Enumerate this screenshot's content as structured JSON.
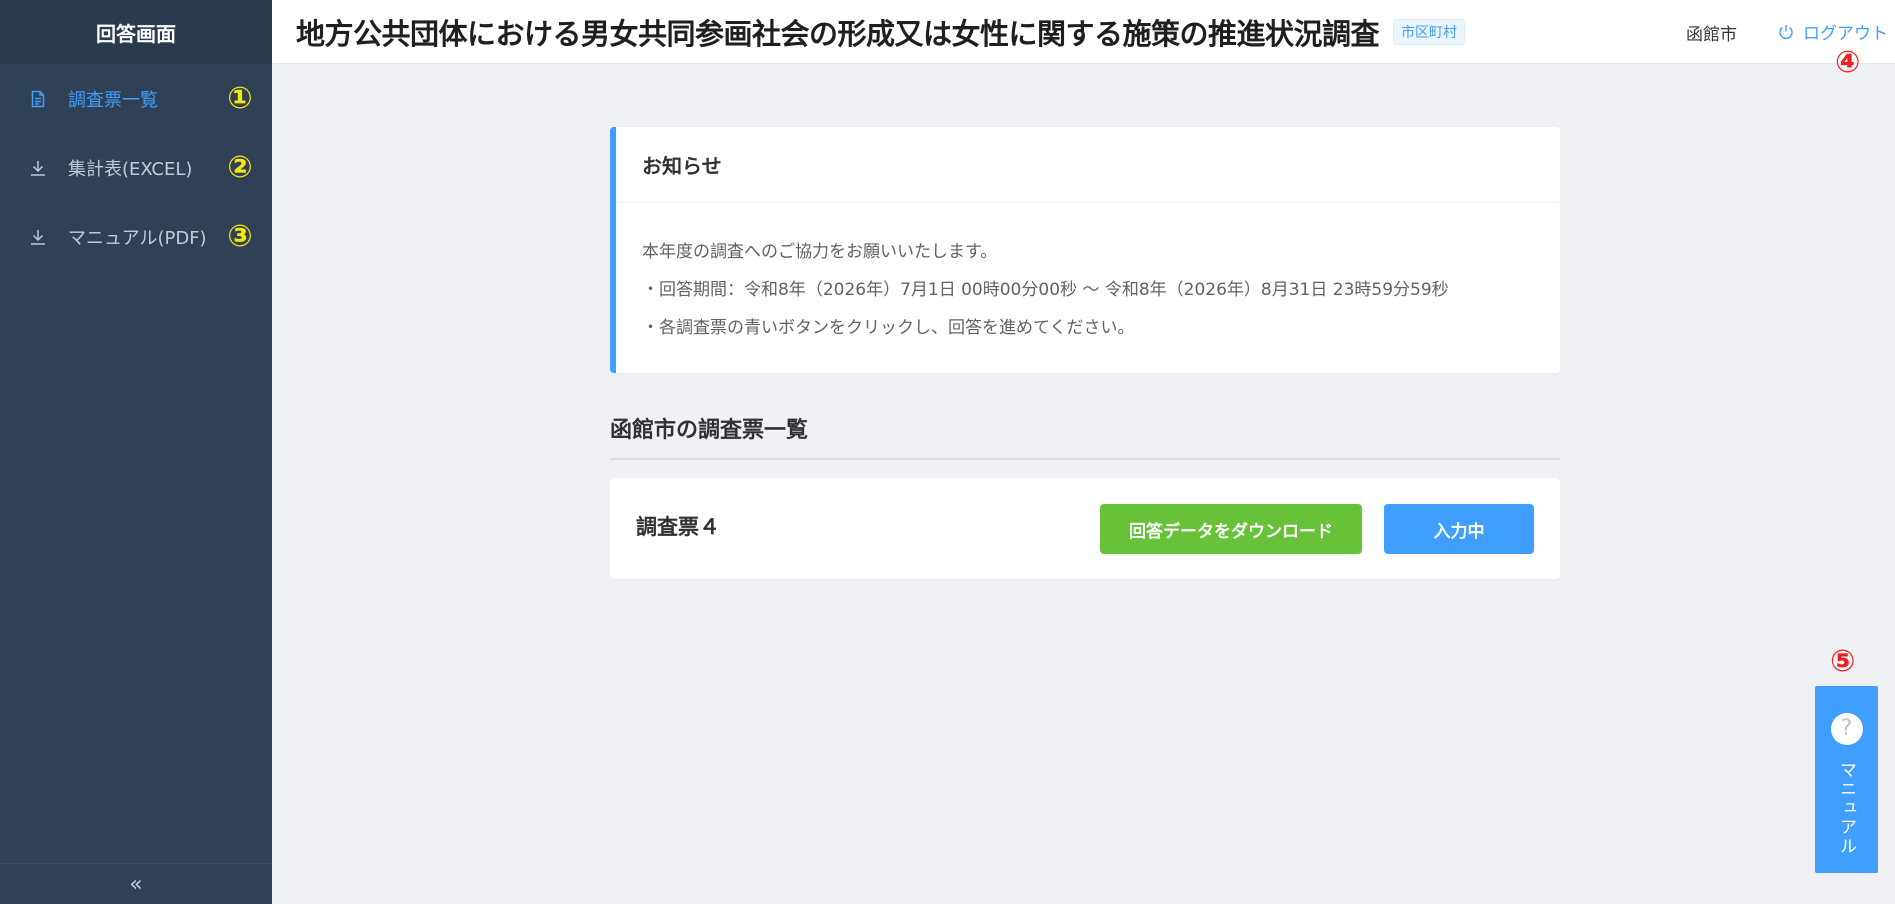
{
  "sidebar": {
    "title": "回答画面",
    "items": [
      {
        "label": "調査票一覧",
        "icon": "document-icon",
        "marker": "①",
        "active": true
      },
      {
        "label": "集計表(EXCEL)",
        "icon": "download-icon",
        "marker": "②",
        "active": false
      },
      {
        "label": "マニュアル(PDF)",
        "icon": "download-icon",
        "marker": "③",
        "active": false
      }
    ],
    "collapse_glyph": "«"
  },
  "header": {
    "title": "地方公共団体における男女共同参画社会の形成又は女性に関する施策の推進状況調査",
    "tag": "市区町村",
    "user": "函館市",
    "logout_label": "ログアウト",
    "logout_marker": "④"
  },
  "notice": {
    "title": "お知らせ",
    "lines": [
      "本年度の調査へのご協力をお願いいたします。",
      "・回答期間：令和8年（2026年）7月1日 00時00分00秒 ～ 令和8年（2026年）8月31日 23時59分59秒",
      "・各調査票の青いボタンをクリックし、回答を進めてください。"
    ]
  },
  "survey_list": {
    "title": "函館市の調査票一覧",
    "items": [
      {
        "name": "調査票４",
        "download_label": "回答データをダウンロード",
        "status_label": "入力中"
      }
    ]
  },
  "floating_manual": {
    "marker": "⑤",
    "icon_glyph": "?",
    "label": "マニュアル"
  },
  "colors": {
    "sidebar_bg": "#304156",
    "accent": "#409eff",
    "success": "#67c23a",
    "marker_yellow": "#f5e60c",
    "marker_red": "#ee1c1c"
  }
}
